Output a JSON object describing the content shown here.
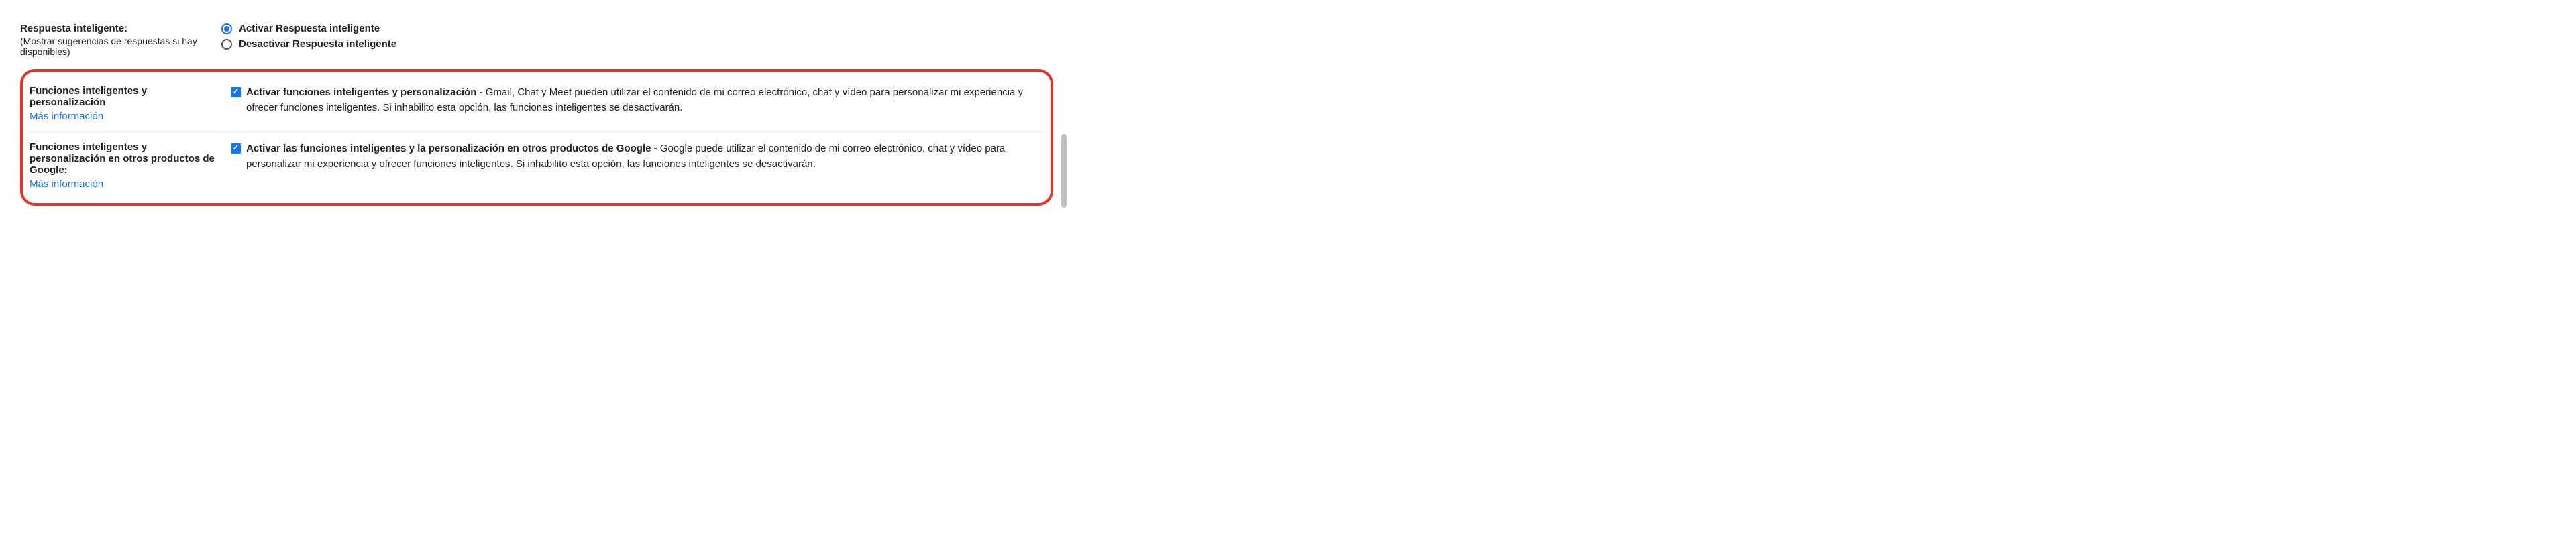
{
  "smartReply": {
    "title": "Respuesta inteligente:",
    "subtitle": "(Mostrar sugerencias de respuestas si hay disponibles)",
    "options": {
      "enable": "Activar Respuesta inteligente",
      "disable": "Desactivar Respuesta inteligente"
    },
    "selected": "enable"
  },
  "smartFeatures": {
    "title": "Funciones inteligentes y personalización",
    "moreInfo": "Más información",
    "checkboxLabel": "Activar funciones inteligentes y personalización - ",
    "description": "Gmail, Chat y Meet pueden utilizar el contenido de mi correo electrónico, chat y vídeo para personalizar mi experiencia y ofrecer funciones inteligentes. Si inhabilito esta opción, las funciones inteligentes se desactivarán.",
    "checked": true
  },
  "smartFeaturesOther": {
    "title": "Funciones inteligentes y personalización en otros productos de Google:",
    "moreInfo": "Más información",
    "checkboxLabel": "Activar las funciones inteligentes y la personalización en otros productos de Google - ",
    "description": "Google puede utilizar el contenido de mi correo electrónico, chat y vídeo para personalizar mi experiencia y ofrecer funciones inteligentes. Si inhabilito esta opción, las funciones inteligentes se desactivarán.",
    "checked": true
  }
}
